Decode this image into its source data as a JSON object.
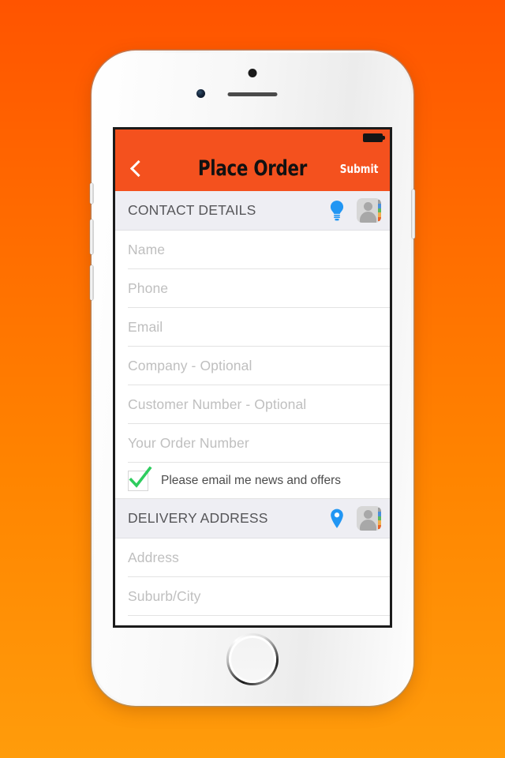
{
  "theme": {
    "background_top": "#FF5400",
    "background_bottom": "#FF9C0B",
    "appbar_color": "#F4511E",
    "accent_blue": "#2196F3",
    "check_green": "#2ECC5E",
    "section_band": "#EEEEF3"
  },
  "statusbar": {
    "battery_icon": "battery-full-icon"
  },
  "appbar": {
    "back_icon": "chevron-left-icon",
    "title": "Place Order",
    "submit_label": "Submit"
  },
  "sections": [
    {
      "id": "contact-details",
      "title": "CONTACT DETAILS",
      "actions": [
        {
          "icon": "lightbulb-icon",
          "name": "hint-bulb"
        },
        {
          "icon": "contacts-book-icon",
          "name": "import-contact"
        }
      ],
      "fields": [
        {
          "name": "name",
          "placeholder": "Name",
          "value": ""
        },
        {
          "name": "phone",
          "placeholder": "Phone",
          "value": ""
        },
        {
          "name": "email",
          "placeholder": "Email",
          "value": ""
        },
        {
          "name": "company",
          "placeholder": "Company - Optional",
          "value": ""
        },
        {
          "name": "customer-number",
          "placeholder": "Customer Number - Optional",
          "value": ""
        },
        {
          "name": "order-number",
          "placeholder": "Your Order Number",
          "value": ""
        }
      ],
      "checkbox": {
        "label": "Please email me news and offers",
        "checked": true
      }
    },
    {
      "id": "delivery-address",
      "title": "DELIVERY ADDRESS",
      "actions": [
        {
          "icon": "map-pin-icon",
          "name": "use-my-location"
        },
        {
          "icon": "contacts-book-icon",
          "name": "import-address"
        }
      ],
      "fields": [
        {
          "name": "address",
          "placeholder": "Address",
          "value": ""
        },
        {
          "name": "suburb-city",
          "placeholder": "Suburb/City",
          "value": ""
        }
      ]
    }
  ]
}
